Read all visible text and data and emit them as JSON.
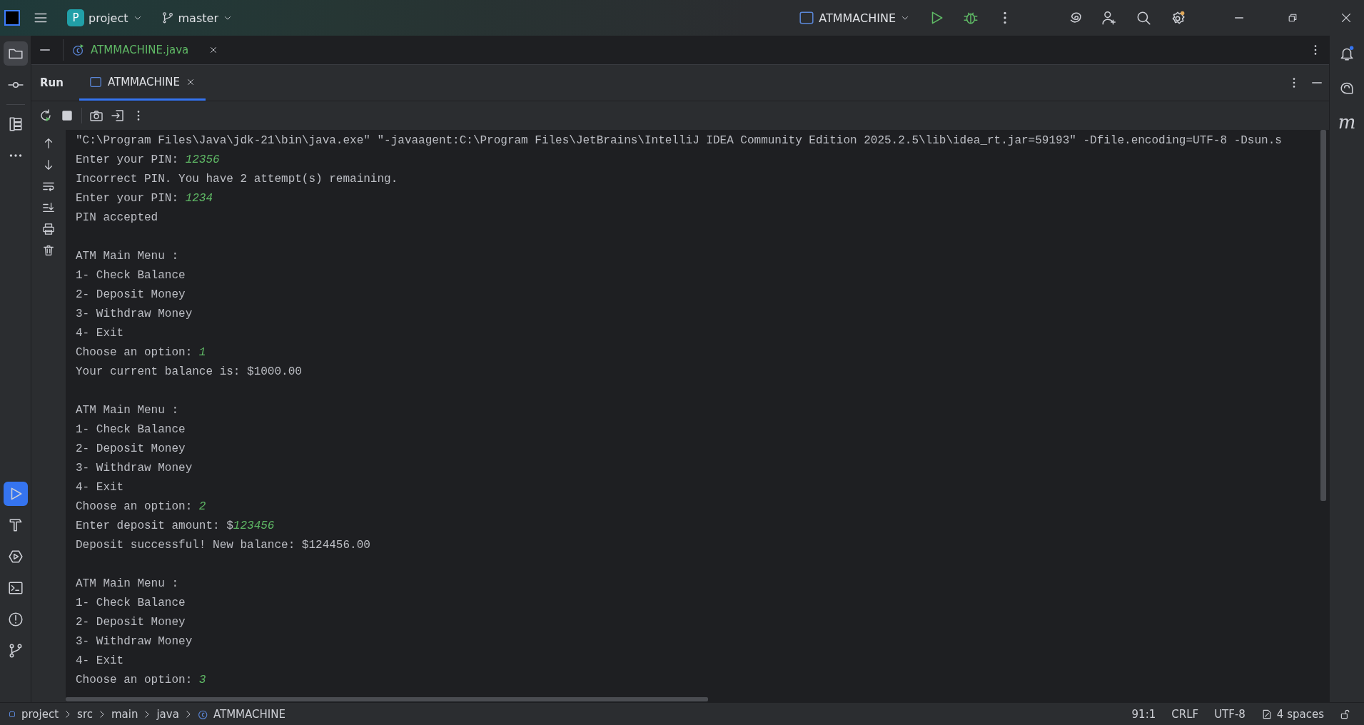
{
  "toolbar": {
    "project": {
      "badge": "P",
      "name": "project"
    },
    "branch": "master",
    "run_config": "ATMMACHINE"
  },
  "left_tools": [
    {
      "kind": "folder",
      "selected": true
    },
    {
      "kind": "commit",
      "selected": false
    },
    {
      "kind": "structure",
      "selected": false
    },
    {
      "kind": "more",
      "selected": false
    },
    {
      "kind": "run",
      "selected": true
    },
    {
      "kind": "build",
      "selected": false
    },
    {
      "kind": "services",
      "selected": false
    },
    {
      "kind": "terminal",
      "selected": false
    },
    {
      "kind": "problems",
      "selected": false
    },
    {
      "kind": "git",
      "selected": false
    }
  ],
  "editor_tabs": [
    {
      "label": "ATMMACHINE.java",
      "selected": true
    }
  ],
  "run_panel": {
    "title": "Run",
    "tabs": [
      {
        "label": "ATMMACHINE",
        "selected": true
      }
    ]
  },
  "console": {
    "blocks": [
      [
        {
          "text": "\"C:\\Program Files\\Java\\jdk-21\\bin\\java.exe\" \"-javaagent:C:\\Program Files\\JetBrains\\IntelliJ IDEA Community Edition 2025.2.5\\lib\\idea_rt.jar=59193\" -Dfile.encoding=UTF-8 -Dsun.s"
        },
        {
          "text": "Enter your PIN: ",
          "input": "12356"
        },
        {
          "text": "Incorrect PIN. You have 2 attempt(s) remaining."
        },
        {
          "text": "Enter your PIN: ",
          "input": "1234"
        },
        {
          "text": "PIN accepted"
        }
      ],
      [
        {
          "text": "ATM Main Menu :"
        },
        {
          "text": "1- Check Balance"
        },
        {
          "text": "2- Deposit Money"
        },
        {
          "text": "3- Withdraw Money"
        },
        {
          "text": "4- Exit"
        },
        {
          "text": "Choose an option: ",
          "input": "1"
        },
        {
          "text": "Your current balance is: $1000.00"
        }
      ],
      [
        {
          "text": "ATM Main Menu :"
        },
        {
          "text": "1- Check Balance"
        },
        {
          "text": "2- Deposit Money"
        },
        {
          "text": "3- Withdraw Money"
        },
        {
          "text": "4- Exit"
        },
        {
          "text": "Choose an option: ",
          "input": "2"
        },
        {
          "text": "Enter deposit amount: $",
          "input": "123456"
        },
        {
          "text": "Deposit successful! New balance: $124456.00"
        }
      ],
      [
        {
          "text": "ATM Main Menu :"
        },
        {
          "text": "1- Check Balance"
        },
        {
          "text": "2- Deposit Money"
        },
        {
          "text": "3- Withdraw Money"
        },
        {
          "text": "4- Exit"
        },
        {
          "text": "Choose an option: ",
          "input": "3"
        }
      ]
    ]
  },
  "right_tools": [
    {
      "kind": "notifications"
    },
    {
      "kind": "ai-chat"
    },
    {
      "kind": "letter",
      "glyph": "m"
    }
  ],
  "status_bar": {
    "breadcrumbs": [
      "project",
      "src",
      "main",
      "java",
      "ATMMACHINE"
    ],
    "position": "91:1",
    "line_separator": "CRLF",
    "encoding": "UTF-8",
    "indent": "4 spaces"
  }
}
